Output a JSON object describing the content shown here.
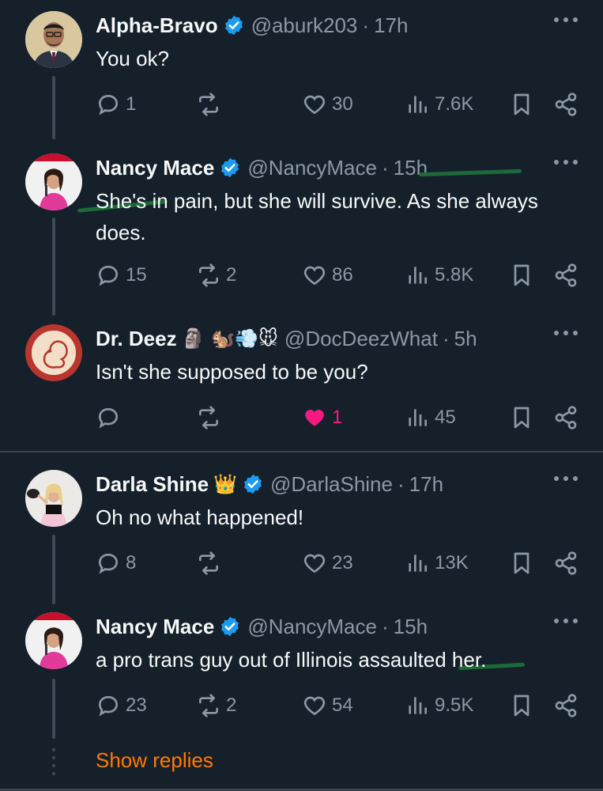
{
  "tweets": [
    {
      "name": "Alpha-Bravo",
      "verified": true,
      "handle": "@aburk203",
      "sep": "·",
      "time": "17h",
      "text": "You ok?",
      "replies": "1",
      "reposts": "",
      "likes": "30",
      "views": "7.6K",
      "liked": false
    },
    {
      "name": "Nancy Mace",
      "verified": true,
      "handle": "@NancyMace",
      "sep": "·",
      "time": "15h",
      "text": "She's in pain, but she will survive. As she always does.",
      "replies": "15",
      "reposts": "2",
      "likes": "86",
      "views": "5.8K",
      "liked": false
    },
    {
      "name": "Dr. Deez",
      "name_emoji": "🗿 🐿️💨🐭",
      "verified": false,
      "handle": "@DocDeezWhat",
      "sep": "·",
      "time": "5h",
      "text": "Isn't she supposed to be you?",
      "replies": "",
      "reposts": "",
      "likes": "1",
      "views": "45",
      "liked": true
    },
    {
      "name": "Darla Shine",
      "name_emoji": "👑",
      "verified": true,
      "handle": "@DarlaShine",
      "sep": "·",
      "time": "17h",
      "text": "Oh no what happened!",
      "replies": "8",
      "reposts": "",
      "likes": "23",
      "views": "13K",
      "liked": false
    },
    {
      "name": "Nancy Mace",
      "verified": true,
      "handle": "@NancyMace",
      "sep": "·",
      "time": "15h",
      "text": "a pro trans guy out of Illinois assaulted her.",
      "replies": "23",
      "reposts": "2",
      "likes": "54",
      "views": "9.5K",
      "liked": false
    }
  ],
  "show_replies_label": "Show replies",
  "colors": {
    "background": "#15202b",
    "verified": "#1d9bf0",
    "muted": "#8b98a5",
    "like_active": "#f91880",
    "show_replies": "#ff7a00"
  },
  "icons": [
    "reply-icon",
    "repost-icon",
    "like-icon",
    "views-icon",
    "bookmark-icon",
    "share-icon",
    "more-icon",
    "verified-icon"
  ]
}
